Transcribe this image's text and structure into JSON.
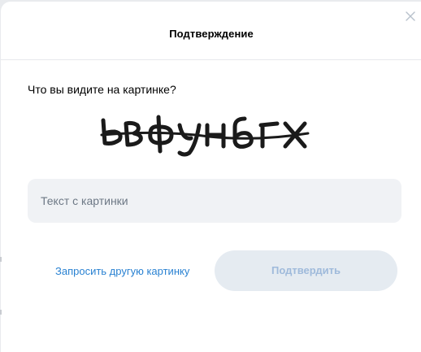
{
  "dialog": {
    "title": "Подтверждение",
    "close_icon": "close-icon"
  },
  "captcha": {
    "prompt": "Что вы видите на картинке?",
    "image_text": "ьвфунбгх",
    "image_alt": "captcha-image"
  },
  "input": {
    "placeholder": "Текст с картинки",
    "value": ""
  },
  "actions": {
    "refresh_label": "Запросить другую картинку",
    "confirm_label": "Подтвердить",
    "confirm_enabled": false
  },
  "colors": {
    "link": "#2a82d2",
    "confirm_bg_disabled": "#e5ebf1",
    "confirm_text_disabled": "#9fbadb",
    "input_bg": "#f0f2f5"
  }
}
